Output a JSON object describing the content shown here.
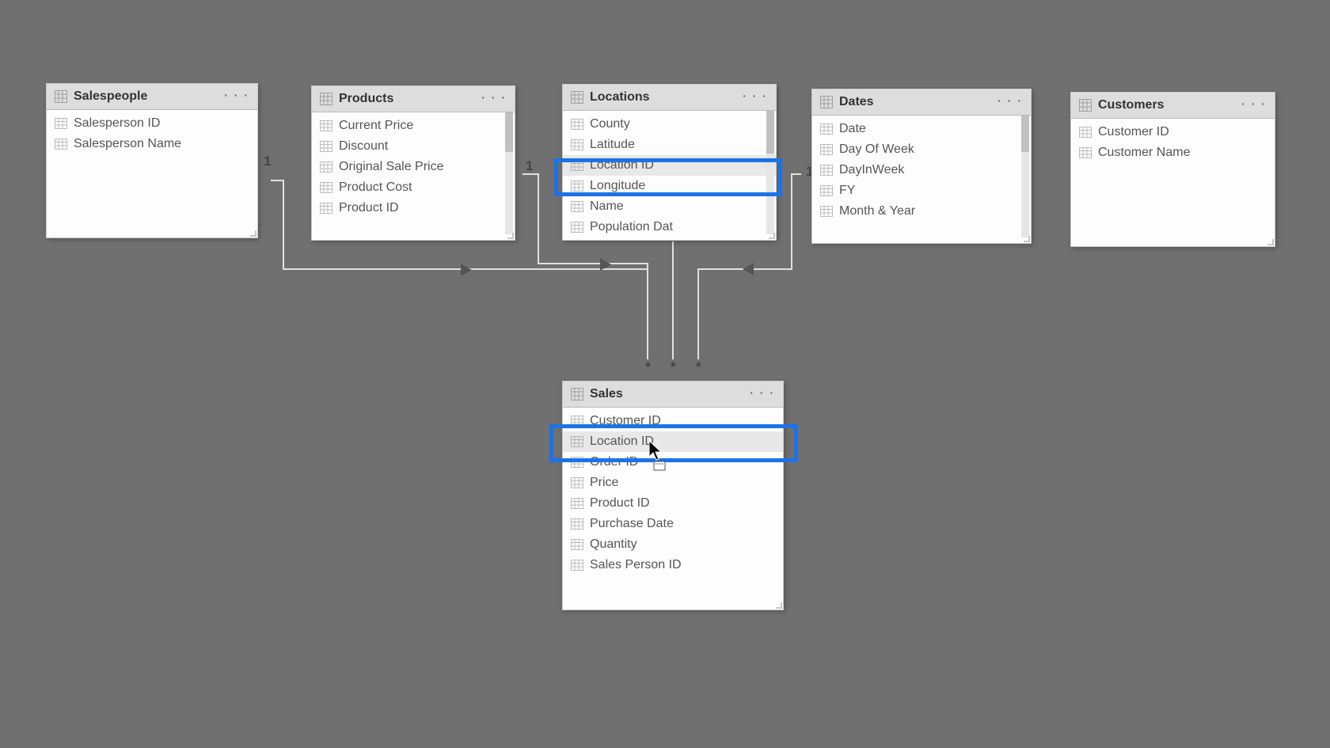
{
  "tables": {
    "salespeople": {
      "title": "Salespeople",
      "fields": [
        "Salesperson ID",
        "Salesperson Name"
      ]
    },
    "products": {
      "title": "Products",
      "fields": [
        "Current Price",
        "Discount",
        "Original Sale Price",
        "Product Cost",
        "Product ID"
      ]
    },
    "locations": {
      "title": "Locations",
      "fields": [
        "County",
        "Latitude",
        "Location ID",
        "Longitude",
        "Name",
        "Population Dat"
      ]
    },
    "dates": {
      "title": "Dates",
      "fields": [
        "Date",
        "Day Of Week",
        "DayInWeek",
        "FY",
        "Month & Year"
      ]
    },
    "customers": {
      "title": "Customers",
      "fields": [
        "Customer ID",
        "Customer Name"
      ]
    },
    "sales": {
      "title": "Sales",
      "fields": [
        "Customer ID",
        "Location ID",
        "Order ID",
        "Price",
        "Product ID",
        "Purchase Date",
        "Quantity",
        "Sales Person ID"
      ]
    }
  },
  "cardinality": {
    "one": "1",
    "many": "*"
  },
  "highlighted_field": "Location ID",
  "ellipsis": "· · ·"
}
